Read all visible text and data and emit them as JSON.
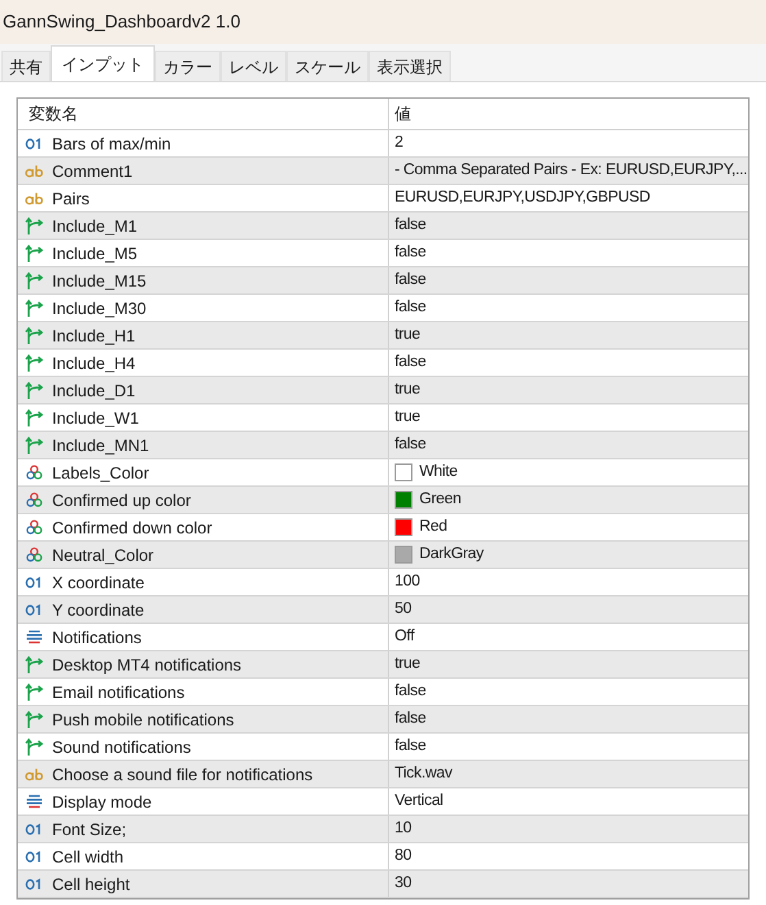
{
  "window": {
    "title": "GannSwing_Dashboardv2 1.0"
  },
  "tabs": [
    {
      "label": "共有",
      "selected": false
    },
    {
      "label": "インプット",
      "selected": true
    },
    {
      "label": "カラー",
      "selected": false
    },
    {
      "label": "レベル",
      "selected": false
    },
    {
      "label": "スケール",
      "selected": false
    },
    {
      "label": "表示選択",
      "selected": false
    }
  ],
  "table": {
    "columns": [
      "変数名",
      "値"
    ],
    "rows": [
      {
        "kind": "int",
        "name": "Bars of max/min",
        "value": "2"
      },
      {
        "kind": "string",
        "name": "Comment1",
        "value": "- Comma Separated Pairs - Ex: EURUSD,EURJPY,..."
      },
      {
        "kind": "string",
        "name": "Pairs",
        "value": "EURUSD,EURJPY,USDJPY,GBPUSD"
      },
      {
        "kind": "bool",
        "name": "Include_M1",
        "value": "false"
      },
      {
        "kind": "bool",
        "name": "Include_M5",
        "value": "false"
      },
      {
        "kind": "bool",
        "name": "Include_M15",
        "value": "false"
      },
      {
        "kind": "bool",
        "name": "Include_M30",
        "value": "false"
      },
      {
        "kind": "bool",
        "name": "Include_H1",
        "value": "true"
      },
      {
        "kind": "bool",
        "name": "Include_H4",
        "value": "false"
      },
      {
        "kind": "bool",
        "name": "Include_D1",
        "value": "true"
      },
      {
        "kind": "bool",
        "name": "Include_W1",
        "value": "true"
      },
      {
        "kind": "bool",
        "name": "Include_MN1",
        "value": "false"
      },
      {
        "kind": "color",
        "name": "Labels_Color",
        "value": "White",
        "color": "#ffffff"
      },
      {
        "kind": "color",
        "name": "Confirmed up color",
        "value": "Green",
        "color": "#008000"
      },
      {
        "kind": "color",
        "name": "Confirmed down color",
        "value": "Red",
        "color": "#ff0000"
      },
      {
        "kind": "color",
        "name": "Neutral_Color",
        "value": "DarkGray",
        "color": "#a9a9a9"
      },
      {
        "kind": "int",
        "name": "X coordinate",
        "value": "100"
      },
      {
        "kind": "int",
        "name": "Y coordinate",
        "value": "50"
      },
      {
        "kind": "enum",
        "name": "Notifications",
        "value": "Off"
      },
      {
        "kind": "bool",
        "name": "Desktop MT4 notifications",
        "value": "true"
      },
      {
        "kind": "bool",
        "name": "Email notifications",
        "value": "false"
      },
      {
        "kind": "bool",
        "name": "Push mobile notifications",
        "value": "false"
      },
      {
        "kind": "bool",
        "name": "Sound notifications",
        "value": "false"
      },
      {
        "kind": "string",
        "name": "Choose a sound file for notifications",
        "value": "Tick.wav"
      },
      {
        "kind": "enum",
        "name": "Display mode",
        "value": "Vertical"
      },
      {
        "kind": "int",
        "name": "Font Size;",
        "value": "10"
      },
      {
        "kind": "int",
        "name": "Cell width",
        "value": "80"
      },
      {
        "kind": "int",
        "name": "Cell height",
        "value": "30"
      }
    ]
  }
}
